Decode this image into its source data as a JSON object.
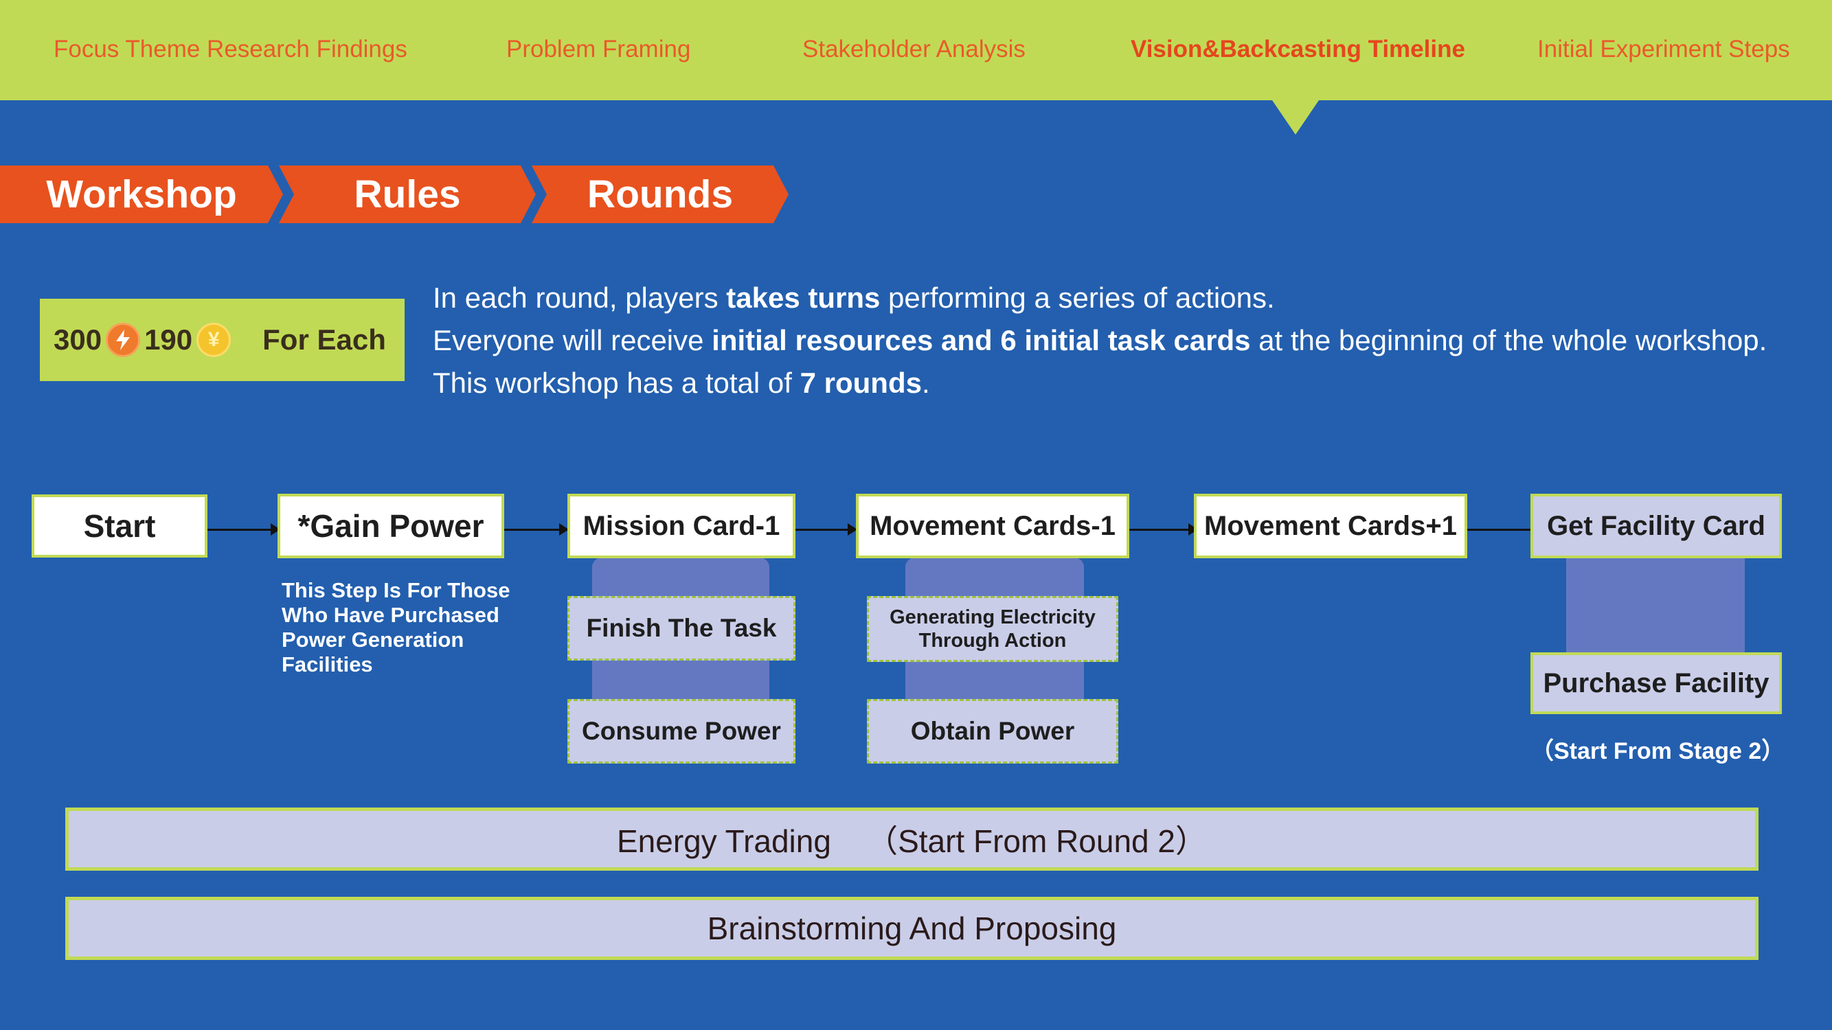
{
  "nav": {
    "items": [
      {
        "label": "Focus Theme Research Findings"
      },
      {
        "label": "Problem Framing"
      },
      {
        "label": "Stakeholder Analysis"
      },
      {
        "label": "Vision&Backcasting Timeline",
        "active": true
      },
      {
        "label": "Initial Experiment Steps"
      }
    ]
  },
  "breadcrumb": {
    "steps": [
      "Workshop",
      "Rules",
      "Rounds"
    ]
  },
  "resources": {
    "energy_amount": "300",
    "energy_icon": "lightning-coin-icon",
    "money_amount": "190",
    "money_icon": "yen-coin-icon",
    "label": "For Each"
  },
  "intro": {
    "line1": {
      "a": "In each round, players ",
      "b": "takes turns",
      "c": " performing a series of actions."
    },
    "line2": {
      "a": "Everyone will receive ",
      "b": "initial resources and 6 initial task cards",
      "c": " at the beginning of the whole workshop."
    },
    "line3": {
      "a": "This workshop has a total of ",
      "b": "7 rounds",
      "c": "."
    }
  },
  "flow": {
    "start": "Start",
    "gain_power": "*Gain Power",
    "gain_power_note": [
      "This Step Is For Those",
      "Who Have Purchased",
      "Power Generation",
      "Facilities"
    ],
    "mission": "Mission Card-1",
    "mission_subs": [
      "Finish The Task",
      "Consume  Power"
    ],
    "movement_minus": "Movement Cards-1",
    "movement_minus_subs": [
      "Generating Electricity",
      "Through Action",
      "Obtain  Power"
    ],
    "movement_plus": "Movement Cards+1",
    "facility": "Get Facility Card",
    "facility_sub": "Purchase Facility",
    "facility_note": "（Start From Stage 2）"
  },
  "bars": {
    "trading": "Energy Trading    （Start From Round 2）",
    "brainstorm": "Brainstorming And Proposing"
  },
  "colors": {
    "background": "#235fae",
    "accent_green": "#c1da55",
    "accent_orange": "#e8521e",
    "card_lavender": "#c9cde8"
  }
}
